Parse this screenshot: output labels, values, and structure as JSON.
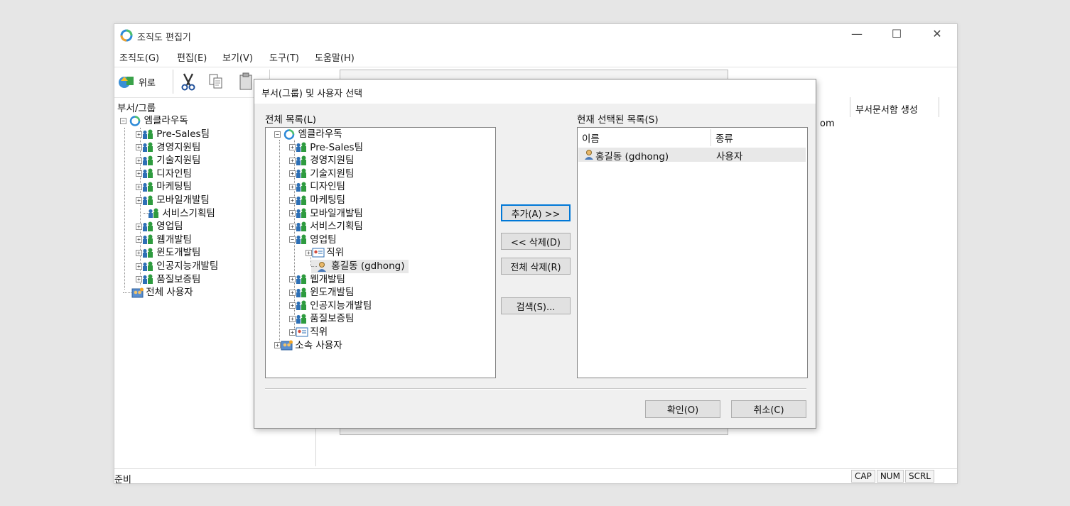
{
  "window": {
    "title": "조직도 편집기",
    "menu": [
      "조직도(G)",
      "편집(E)",
      "보기(V)",
      "도구(T)",
      "도움말(H)"
    ],
    "toolbar_up_label": "위로",
    "left_header": "부서/그룹",
    "right_col_header": "부서문서함 생성",
    "right_partial_text": "om",
    "tree": {
      "root": "엠클라우독",
      "items": [
        "Pre-Sales팀",
        "경영지원팀",
        "기술지원팀",
        "디자인팀",
        "마케팅팀",
        "모바일개발팀",
        "서비스기획팀",
        "영업팀",
        "웹개발팀",
        "윈도개발팀",
        "인공지능개발팀",
        "품질보증팀"
      ],
      "all_users": "전체 사용자"
    },
    "status": {
      "ready": "준비",
      "cap": "CAP",
      "num": "NUM",
      "scrl": "SCRL"
    }
  },
  "dialog": {
    "title": "부서(그룹) 및 사용자 선택",
    "left_label": "전체 목록(L)",
    "right_label": "현재 선택된 목록(S)",
    "tree": {
      "root": "엠클라우독",
      "items_before": [
        "Pre-Sales팀",
        "경영지원팀",
        "기술지원팀",
        "디자인팀",
        "마케팅팀",
        "모바일개발팀",
        "서비스기획팀"
      ],
      "expanded_item": "영업팀",
      "expanded_children": {
        "position": "직위",
        "user": "홍길동 (gdhong)"
      },
      "items_after": [
        "웹개발팀",
        "윈도개발팀",
        "인공지능개발팀",
        "품질보증팀"
      ],
      "position": "직위",
      "affiliated_users": "소속 사용자"
    },
    "selected_list": {
      "columns": [
        "이름",
        "종류"
      ],
      "rows": [
        {
          "name": "홍길동 (gdhong)",
          "type": "사용자"
        }
      ]
    },
    "buttons": {
      "add": "추가(A) >>",
      "delete": "<< 삭제(D)",
      "delete_all": "전체 삭제(R)",
      "search": "검색(S)...",
      "ok": "확인(O)",
      "cancel": "취소(C)"
    }
  },
  "colors": {
    "accent": "#0078d7",
    "selected_row": "#e8e8e8",
    "group_icon_green": "#2e9b3f",
    "group_icon_blue": "#2d6fb5"
  }
}
